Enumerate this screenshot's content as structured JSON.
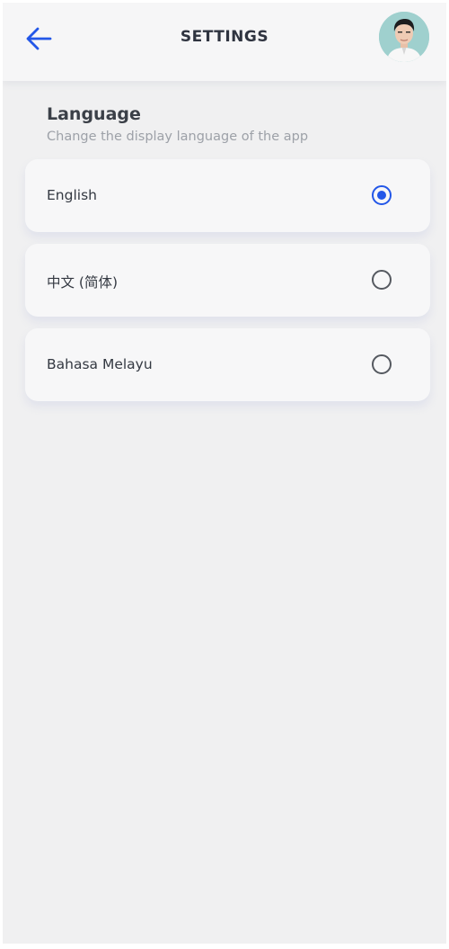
{
  "header": {
    "title": "SETTINGS",
    "back_icon": "arrow-left-icon",
    "avatar_icon": "user-avatar-photo"
  },
  "language": {
    "title": "Language",
    "subtitle": "Change the display language of the app",
    "options": [
      {
        "label": "English",
        "selected": true
      },
      {
        "label": "中文 (简体)",
        "selected": false
      },
      {
        "label": "Bahasa Melayu",
        "selected": false
      }
    ]
  },
  "colors": {
    "accent": "#2357e8",
    "background": "#f0f0f1",
    "card": "#f7f7f8"
  }
}
